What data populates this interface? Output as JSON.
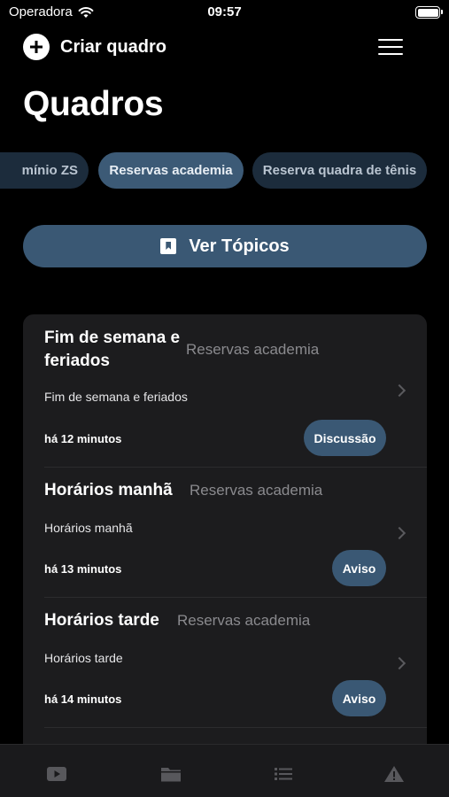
{
  "status_bar": {
    "carrier": "Operadora",
    "time": "09:57"
  },
  "nav": {
    "create_label": "Criar quadro"
  },
  "page_title": "Quadros",
  "boards": [
    {
      "label": "mínio ZS",
      "active": false
    },
    {
      "label": "Reservas academia",
      "active": true
    },
    {
      "label": "Reserva quadra de tênis",
      "active": false
    }
  ],
  "topics_button": {
    "label": "Ver Tópicos"
  },
  "topics": [
    {
      "title": "Fim de semana e feriados",
      "board": "Reservas academia",
      "description": "Fim de semana e feriados",
      "time": "há 12 minutos",
      "tag": "Discussão"
    },
    {
      "title": "Horários manhã",
      "board": "Reservas academia",
      "description": "Horários manhã",
      "time": "há 13 minutos",
      "tag": "Aviso"
    },
    {
      "title": "Horários tarde",
      "board": "Reservas academia",
      "description": "Horários tarde",
      "time": "há 14 minutos",
      "tag": "Aviso"
    }
  ],
  "tab_bar": {
    "items": [
      {
        "icon": "play-video-icon"
      },
      {
        "icon": "folder-icon"
      },
      {
        "icon": "list-icon"
      },
      {
        "icon": "warning-icon"
      }
    ]
  },
  "colors": {
    "background": "#000000",
    "accent": "#3a5874",
    "card": "#1c1c1e",
    "chip": "#1c2c3c",
    "muted_text": "#8a8a8e"
  }
}
